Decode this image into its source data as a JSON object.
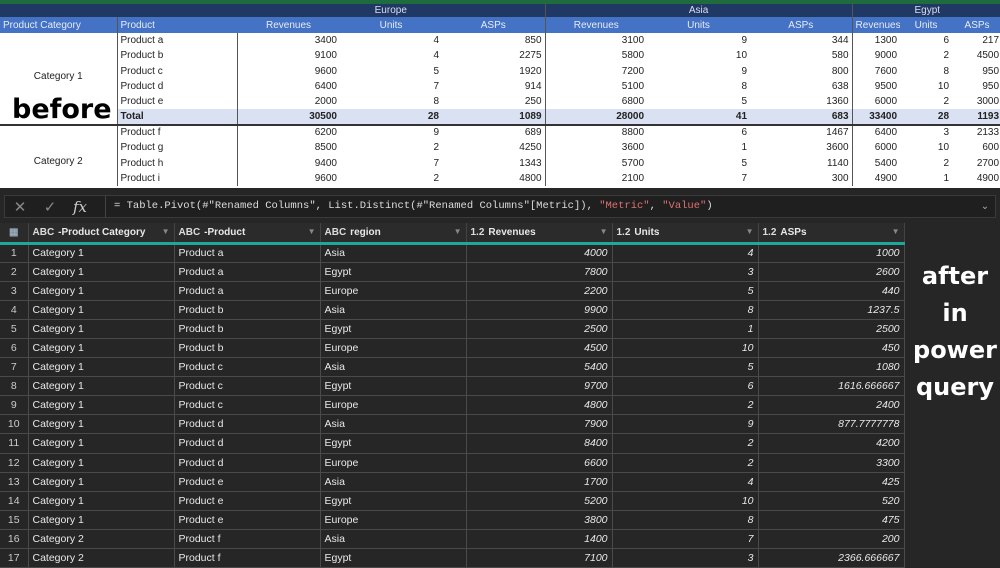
{
  "excel": {
    "regions": [
      "Europe",
      "Asia",
      "Egypt"
    ],
    "headers": {
      "category": "Product Category",
      "product": "Product",
      "metrics": [
        "Revenues",
        "Units",
        "ASPs"
      ]
    },
    "rows": [
      {
        "category": "Category 1",
        "product": "Product a",
        "values": [
          "3400",
          "4",
          "850",
          "3100",
          "9",
          "344",
          "1300",
          "6",
          "217"
        ]
      },
      {
        "category": "",
        "product": "Product b",
        "values": [
          "9100",
          "4",
          "2275",
          "5800",
          "10",
          "580",
          "9000",
          "2",
          "4500"
        ]
      },
      {
        "category": "",
        "product": "Product c",
        "values": [
          "9600",
          "5",
          "1920",
          "7200",
          "9",
          "800",
          "7600",
          "8",
          "950"
        ]
      },
      {
        "category": "",
        "product": "Product d",
        "values": [
          "6400",
          "7",
          "914",
          "5100",
          "8",
          "638",
          "9500",
          "10",
          "950"
        ]
      },
      {
        "category": "",
        "product": "Product e",
        "values": [
          "2000",
          "8",
          "250",
          "6800",
          "5",
          "1360",
          "6000",
          "2",
          "3000"
        ]
      },
      {
        "category": "",
        "product": "Total",
        "values": [
          "30500",
          "28",
          "1089",
          "28000",
          "41",
          "683",
          "33400",
          "28",
          "1193"
        ],
        "total": true
      },
      {
        "category": "Category 2",
        "product": "Product f",
        "values": [
          "6200",
          "9",
          "689",
          "8800",
          "6",
          "1467",
          "6400",
          "3",
          "2133"
        ]
      },
      {
        "category": "",
        "product": "Product g",
        "values": [
          "8500",
          "2",
          "4250",
          "3600",
          "1",
          "3600",
          "6000",
          "10",
          "600"
        ]
      },
      {
        "category": "",
        "product": "Product h",
        "values": [
          "9400",
          "7",
          "1343",
          "5700",
          "5",
          "1140",
          "5400",
          "2",
          "2700"
        ]
      },
      {
        "category": "",
        "product": "Product i",
        "values": [
          "9600",
          "2",
          "4800",
          "2100",
          "7",
          "300",
          "4900",
          "1",
          "4900"
        ]
      }
    ],
    "overlay_label": "before"
  },
  "formula_bar": {
    "prefix": "= Table.Pivot(#\"Renamed Columns\", List.Distinct(#\"Renamed Columns\"[Metric]), ",
    "arg1": "\"Metric\"",
    "sep": ", ",
    "arg2": "\"Value\"",
    "suffix": ")"
  },
  "power_query": {
    "columns": [
      {
        "type": "ABC",
        "name": "-Product Category"
      },
      {
        "type": "ABC",
        "name": "-Product"
      },
      {
        "type": "ABC",
        "name": "region"
      },
      {
        "type": "1.2",
        "name": "Revenues"
      },
      {
        "type": "1.2",
        "name": "Units"
      },
      {
        "type": "1.2",
        "name": "ASPs"
      }
    ],
    "rows": [
      [
        "1",
        "Category 1",
        "Product a",
        "Asia",
        "4000",
        "4",
        "1000"
      ],
      [
        "2",
        "Category 1",
        "Product a",
        "Egypt",
        "7800",
        "3",
        "2600"
      ],
      [
        "3",
        "Category 1",
        "Product a",
        "Europe",
        "2200",
        "5",
        "440"
      ],
      [
        "4",
        "Category 1",
        "Product b",
        "Asia",
        "9900",
        "8",
        "1237.5"
      ],
      [
        "5",
        "Category 1",
        "Product b",
        "Egypt",
        "2500",
        "1",
        "2500"
      ],
      [
        "6",
        "Category 1",
        "Product b",
        "Europe",
        "4500",
        "10",
        "450"
      ],
      [
        "7",
        "Category 1",
        "Product c",
        "Asia",
        "5400",
        "5",
        "1080"
      ],
      [
        "8",
        "Category 1",
        "Product c",
        "Egypt",
        "9700",
        "6",
        "1616.666667"
      ],
      [
        "9",
        "Category 1",
        "Product c",
        "Europe",
        "4800",
        "2",
        "2400"
      ],
      [
        "10",
        "Category 1",
        "Product d",
        "Asia",
        "7900",
        "9",
        "877.7777778"
      ],
      [
        "11",
        "Category 1",
        "Product d",
        "Egypt",
        "8400",
        "2",
        "4200"
      ],
      [
        "12",
        "Category 1",
        "Product d",
        "Europe",
        "6600",
        "2",
        "3300"
      ],
      [
        "13",
        "Category 1",
        "Product e",
        "Asia",
        "1700",
        "4",
        "425"
      ],
      [
        "14",
        "Category 1",
        "Product e",
        "Egypt",
        "5200",
        "10",
        "520"
      ],
      [
        "15",
        "Category 1",
        "Product e",
        "Europe",
        "3800",
        "8",
        "475"
      ],
      [
        "16",
        "Category 2",
        "Product f",
        "Asia",
        "1400",
        "7",
        "200"
      ],
      [
        "17",
        "Category 2",
        "Product f",
        "Egypt",
        "7100",
        "3",
        "2366.666667"
      ]
    ],
    "overlay_label": [
      "after",
      "in",
      "power",
      "query"
    ]
  }
}
